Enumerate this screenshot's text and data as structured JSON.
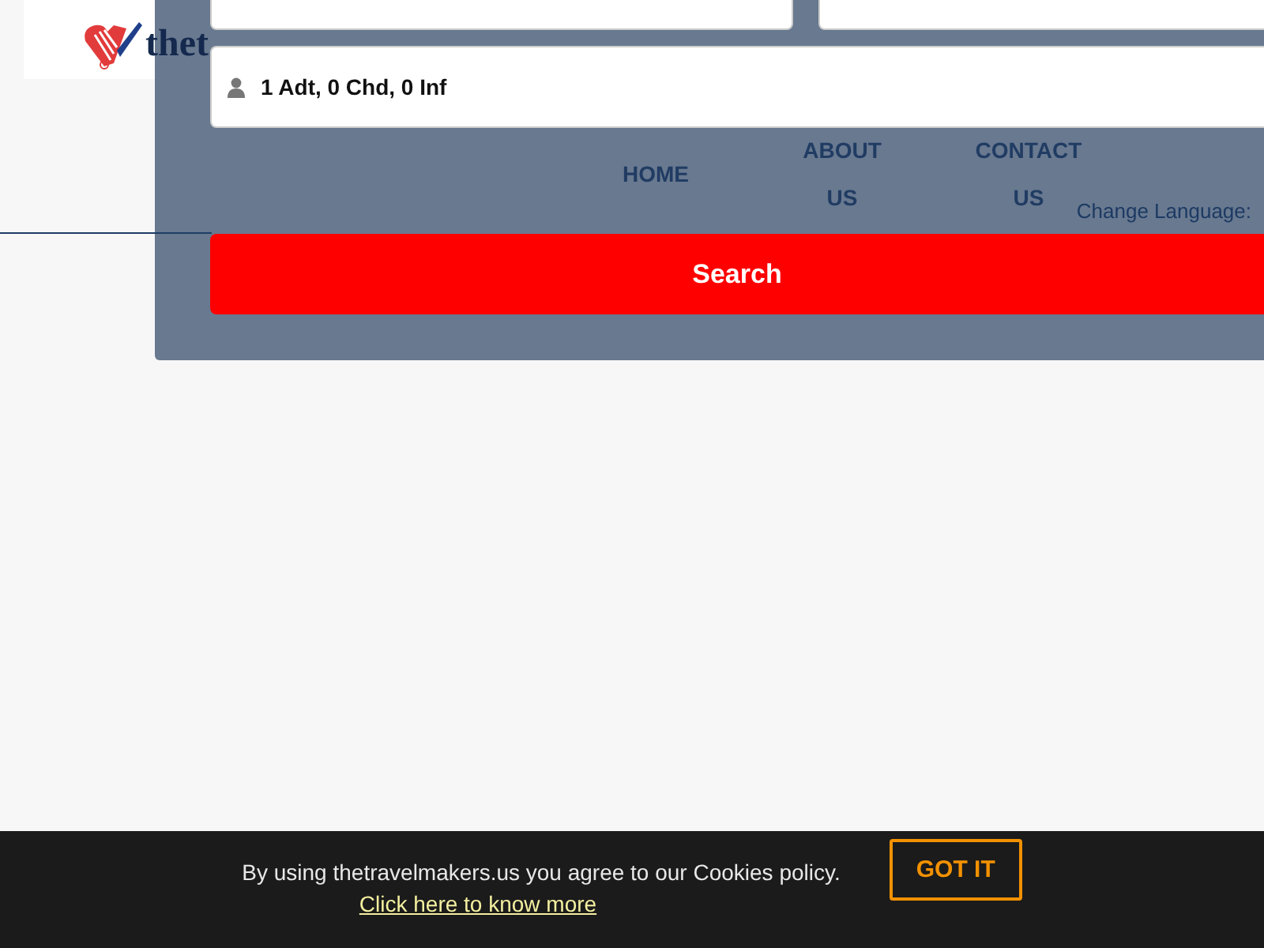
{
  "header": {
    "logo_text": "thet",
    "nav": [
      {
        "label": "HOME"
      },
      {
        "label": "ABOUT US"
      },
      {
        "label": "CONTACT US"
      }
    ],
    "language_label": "Change Language:"
  },
  "search_panel": {
    "passengers": "1 Adt, 0 Chd, 0 Inf",
    "search_button": "Search"
  },
  "cookie_bar": {
    "message": "By using thetravelmakers.us you agree to our Cookies policy.",
    "link": "Click here to know more",
    "button": "GOT IT"
  }
}
